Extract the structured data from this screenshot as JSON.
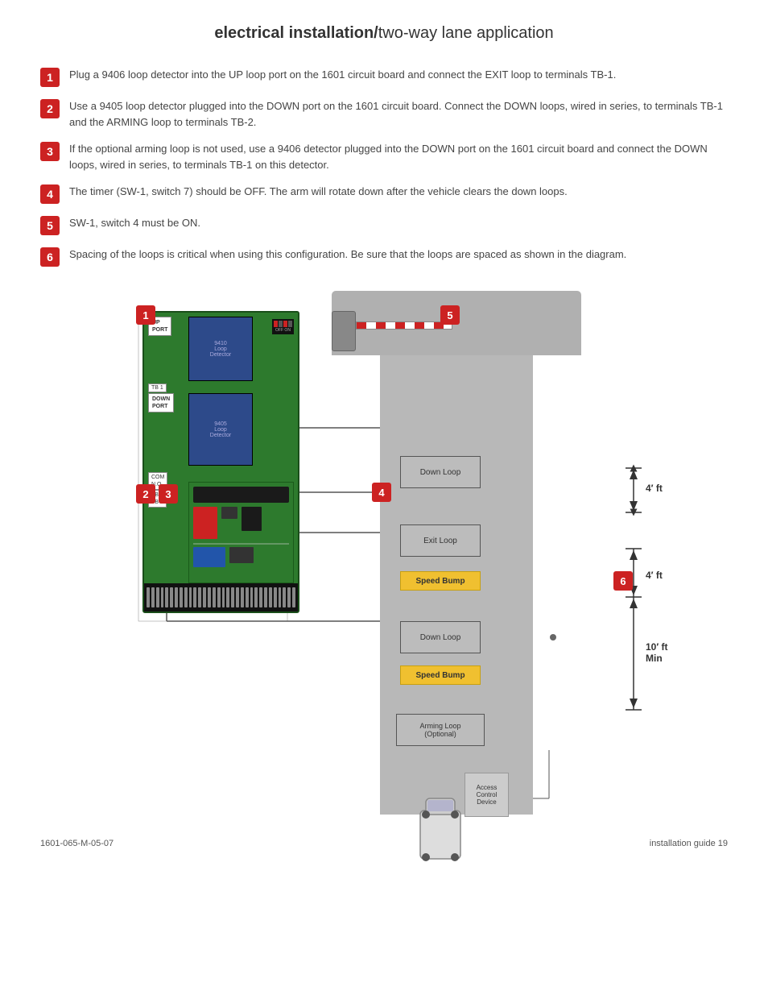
{
  "page": {
    "title_bold": "electrical installation/",
    "title_normal": "two-way lane application",
    "footer_left": "1601-065-M-05-07",
    "footer_right": "installation guide   19"
  },
  "steps": [
    {
      "number": "1",
      "text": "Plug a 9406 loop detector into the UP loop port on the 1601 circuit board and connect the EXIT loop to terminals TB-1."
    },
    {
      "number": "2",
      "text": "Use a 9405 loop detector plugged into the DOWN port on the 1601 circuit board.  Connect the DOWN loops, wired in series, to terminals TB-1 and the ARMING loop to terminals TB-2."
    },
    {
      "number": "3",
      "text": "If the optional arming loop is not used, use a 9406 detector plugged into the DOWN port on the 1601 circuit board and connect the DOWN loops, wired in series, to terminals TB-1 on this detector."
    },
    {
      "number": "4",
      "text": "The timer (SW-1, switch 7) should be OFF.  The arm will rotate down after the vehicle clears the down loops."
    },
    {
      "number": "5",
      "text": "SW-1, switch 4 must be ON."
    },
    {
      "number": "6",
      "text": "Spacing of the loops is critical when using this configuration.  Be sure that the loops are spaced as shown in the diagram."
    }
  ],
  "diagram": {
    "labels": {
      "up_port": "UP PORT",
      "down_port": "DOWN PORT",
      "detector_9410": "9410\nLoop\nDetector",
      "detector_9405": "9405\nLoop\nDetector",
      "tb1_up": "TB 1",
      "tb2_tb1": "TB 2\nTB 1",
      "com_no": "COM\nN.O.",
      "down_loop_1": "Down Loop",
      "exit_loop": "Exit Loop",
      "speed_bump_1": "Speed Bump",
      "down_loop_2": "Down Loop",
      "speed_bump_2": "Speed Bump",
      "arming_loop": "Arming Loop\n(Optional)",
      "access_control": "Access\nControl\nDevice",
      "measure_4ft_1": "4′ ft",
      "measure_4ft_2": "4′ ft",
      "measure_10ft": "10′ ft\nMin"
    },
    "badges": [
      "1",
      "2",
      "3",
      "4",
      "5",
      "6"
    ]
  }
}
